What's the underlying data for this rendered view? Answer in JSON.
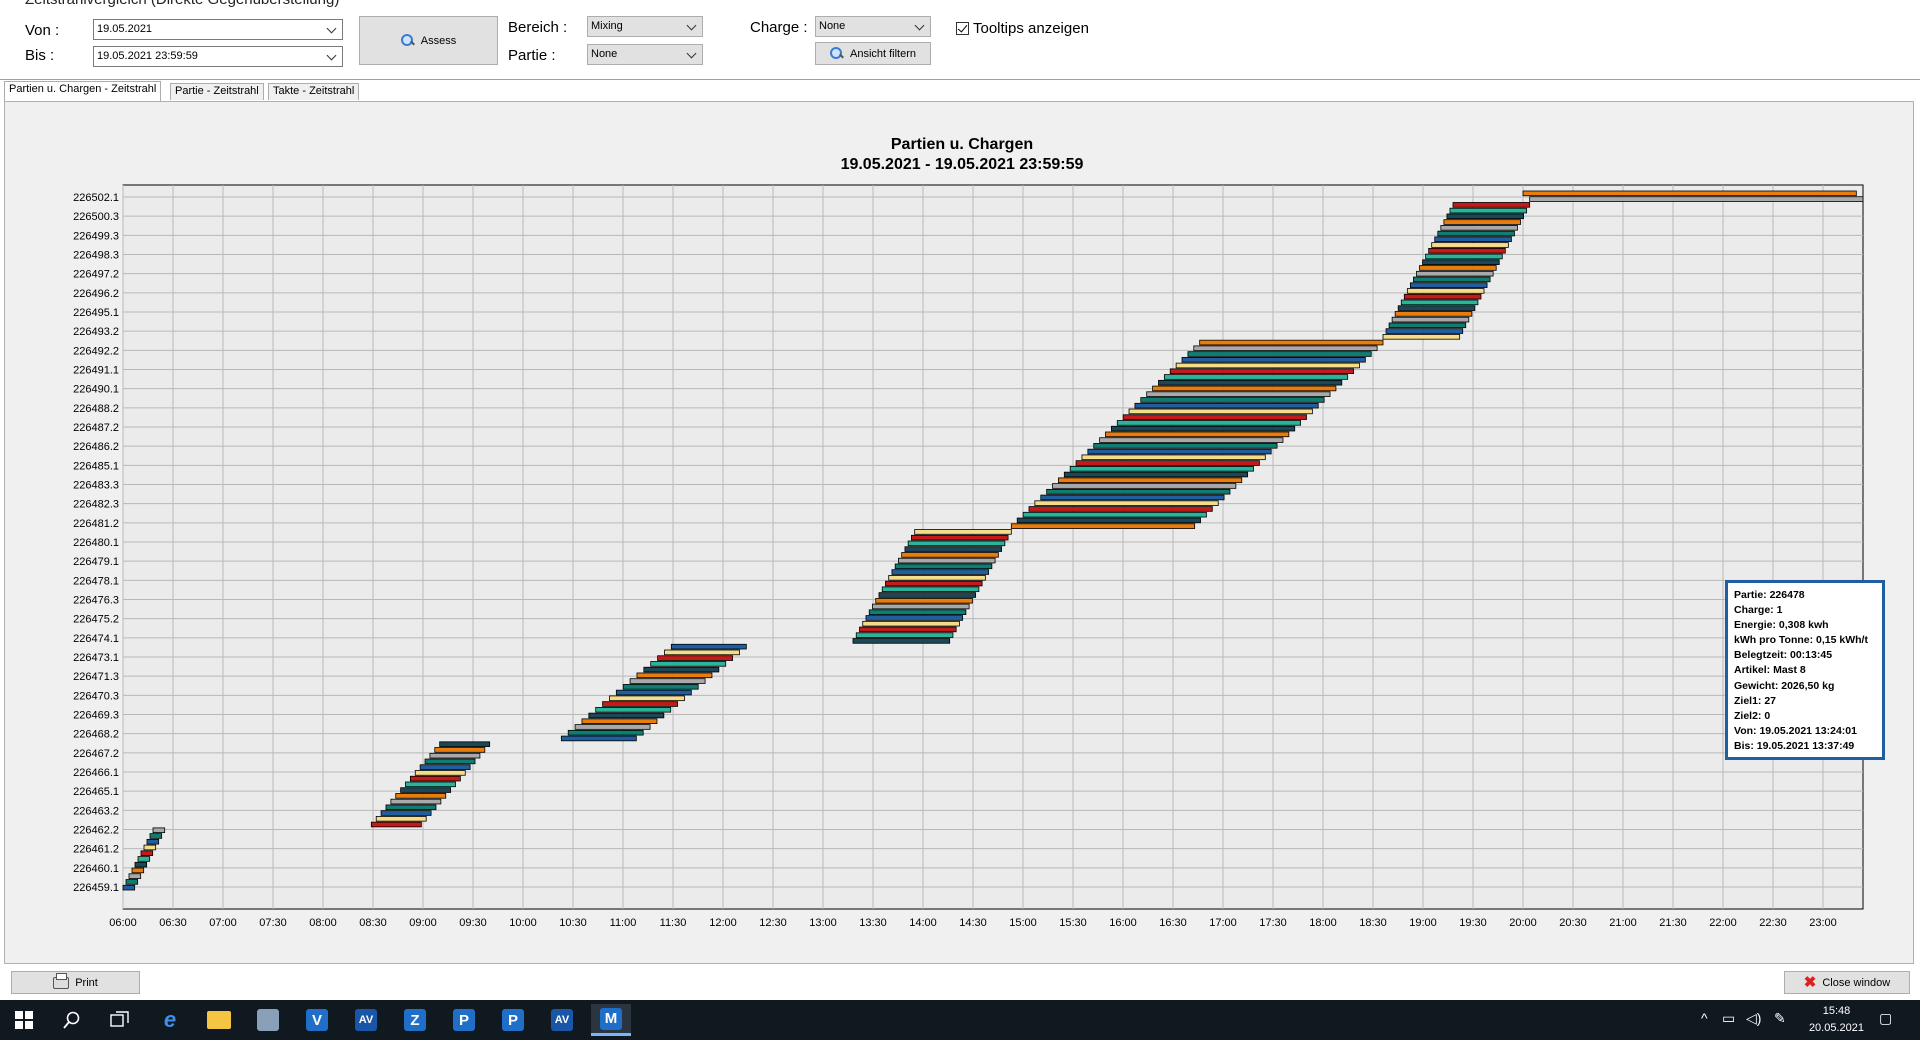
{
  "window_title": "Zeitstrahlvergleich (Direkte Gegenüberstellung)",
  "filters": {
    "von_label": "Von :",
    "von_value": "19.05.2021",
    "bis_label": "Bis :",
    "bis_value": "19.05.2021 23:59:59",
    "assess_label": "Assess",
    "bereich_label": "Bereich :",
    "bereich_value": "Mixing",
    "partie_label": "Partie :",
    "partie_value": "None",
    "charge_label": "Charge :",
    "charge_value": "None",
    "ansicht_filtern_label": "Ansicht filtern",
    "tooltips_label": "Tooltips anzeigen",
    "tooltips_checked": true
  },
  "tabs": [
    {
      "label": "Partien u. Chargen - Zeitstrahl",
      "active": true
    },
    {
      "label": "Partie - Zeitstrahl",
      "active": false
    },
    {
      "label": "Takte - Zeitstrahl",
      "active": false
    }
  ],
  "chart_data": {
    "type": "gantt",
    "title": "Partien u. Chargen",
    "subtitle": "19.05.2021 - 19.05.2021 23:59:59",
    "y_ticks": [
      "226502.1",
      "226500.3",
      "226499.3",
      "226498.3",
      "226497.2",
      "226496.2",
      "226495.1",
      "226493.2",
      "226492.2",
      "226491.1",
      "226490.1",
      "226488.2",
      "226487.2",
      "226486.2",
      "226485.1",
      "226483.3",
      "226482.3",
      "226481.2",
      "226480.1",
      "226479.1",
      "226478.1",
      "226476.3",
      "226475.2",
      "226474.1",
      "226473.1",
      "226471.3",
      "226470.3",
      "226469.3",
      "226468.2",
      "226467.2",
      "226466.1",
      "226465.1",
      "226463.2",
      "226462.2",
      "226461.2",
      "226460.1",
      "226459.1"
    ],
    "x_ticks": [
      "06:00",
      "06:30",
      "07:00",
      "07:30",
      "08:00",
      "08:30",
      "09:00",
      "09:30",
      "10:00",
      "10:30",
      "11:00",
      "11:30",
      "12:00",
      "12:30",
      "13:00",
      "13:30",
      "14:00",
      "14:30",
      "15:00",
      "15:30",
      "16:00",
      "16:30",
      "17:00",
      "17:30",
      "18:00",
      "18:30",
      "19:00",
      "19:30",
      "20:00",
      "20:30",
      "21:00",
      "21:30",
      "22:00",
      "22:30",
      "23:00"
    ],
    "x_range": [
      "06:00",
      "23:20"
    ],
    "grid": true,
    "palette": [
      "#1f5fa0",
      "#e87c0c",
      "#c51a1a",
      "#0f7d72",
      "#1c4756",
      "#f3dd8a",
      "#a9a9a9",
      "#2ab49a"
    ],
    "groups": [
      {
        "start": "06:00",
        "count": 11,
        "finish": "06:25",
        "bar_min": 7
      },
      {
        "start": "08:29",
        "count": 15,
        "finish": "09:40",
        "bar_min": 30
      },
      {
        "start": "10:23",
        "count": 17,
        "finish": "12:14",
        "bar_min": 45
      },
      {
        "start": "13:18",
        "count": 20,
        "finish": "14:53",
        "bar_min": 58
      },
      {
        "start": "14:53",
        "count": 33,
        "finish": "18:36",
        "bar_min": 110
      },
      {
        "start": "18:36",
        "count": 24,
        "finish": "20:04",
        "bar_min": 46
      },
      {
        "start": "20:04",
        "count": 2,
        "finish": "23:20",
        "bar_min": 200
      }
    ]
  },
  "tooltip": {
    "lines": [
      "Partie: 226478",
      "Charge: 1",
      "Energie: 0,308 kwh",
      "kWh pro Tonne: 0,15 kWh/t",
      "Belegtzeit: 00:13:45",
      "Artikel: Mast 8",
      "Gewicht: 2026,50 kg",
      "Ziel1: 27",
      "Ziel2: 0",
      "Von: 19.05.2021 13:24:01",
      "Bis: 19.05.2021 13:37:49"
    ]
  },
  "bottom": {
    "print_label": "Print",
    "close_label": "Close window"
  },
  "taskbar": {
    "apps": [
      "windows-start",
      "search",
      "task-view",
      "edge",
      "explorer",
      "app",
      "V",
      "AV",
      "Z",
      "P",
      "P",
      "AV",
      "M"
    ],
    "time": "15:48",
    "date": "20.05.2021"
  }
}
